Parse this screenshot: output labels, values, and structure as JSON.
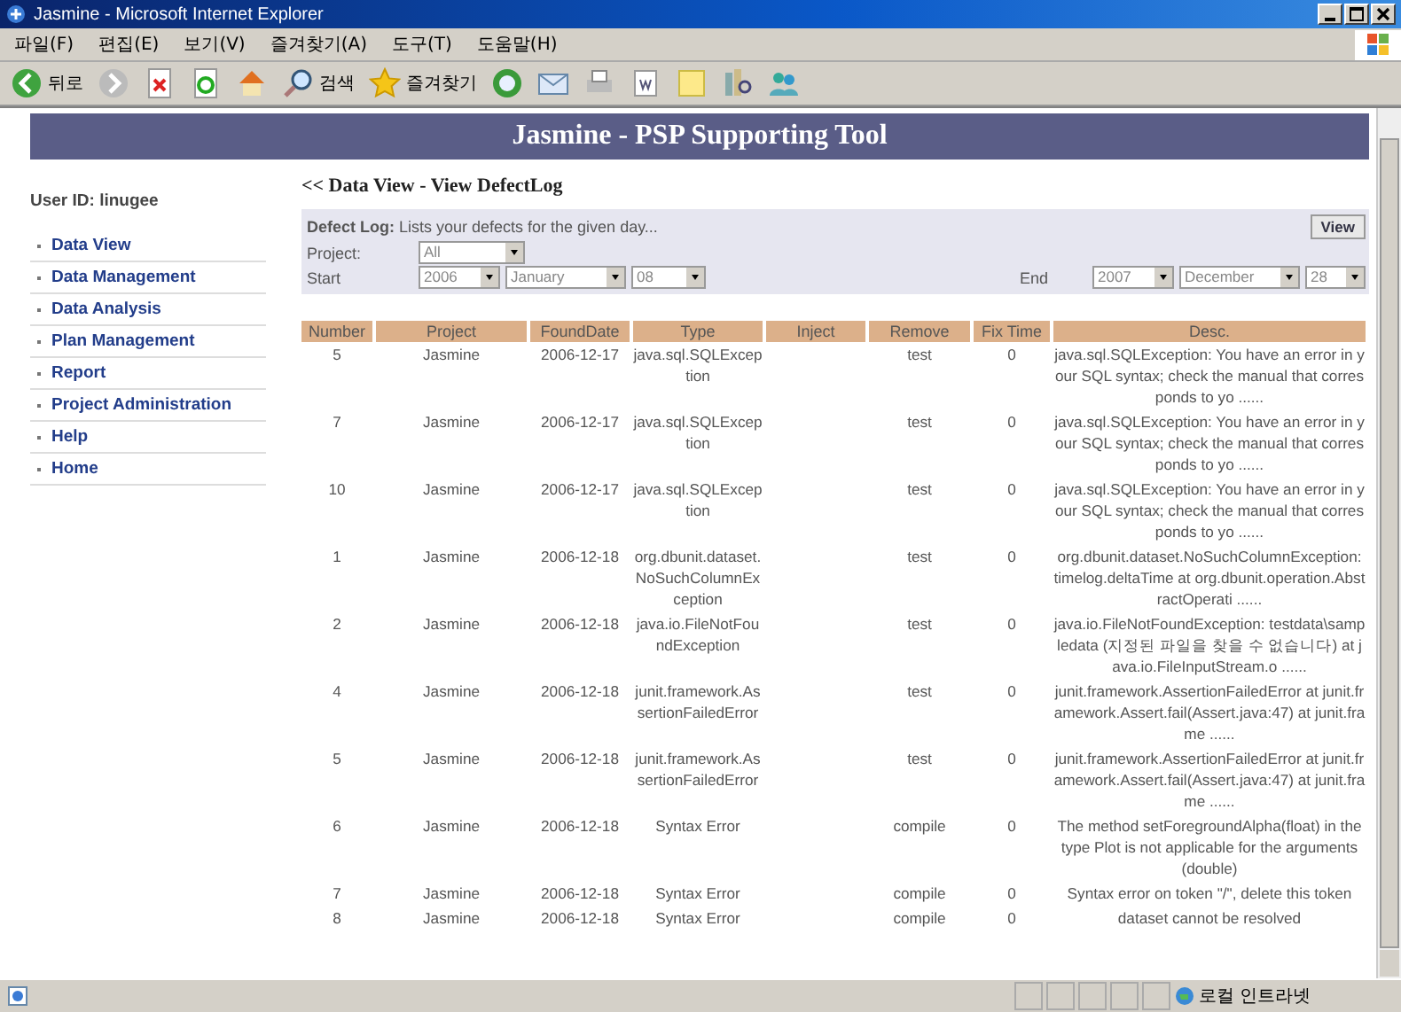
{
  "window": {
    "title": "Jasmine - Microsoft Internet Explorer"
  },
  "menu": [
    "파일(F)",
    "편집(E)",
    "보기(V)",
    "즐겨찾기(A)",
    "도구(T)",
    "도움말(H)"
  ],
  "toolbar": {
    "back": "뒤로",
    "search": "검색",
    "favorites": "즐겨찾기"
  },
  "banner": "Jasmine - PSP Supporting Tool",
  "sidebar": {
    "user": "User ID: linugee",
    "items": [
      "Data View",
      "Data Management",
      "Data Analysis",
      "Plan Management",
      "Report",
      "Project Administration",
      "Help",
      "Home"
    ]
  },
  "breadcrumb": "<< Data View - View DefectLog",
  "filter": {
    "heading": "Defect Log:",
    "description": "Lists your defects for the given day...",
    "button": "View",
    "project_label": "Project:",
    "project": "All",
    "start_label": "Start",
    "start": [
      "2006",
      "January",
      "08"
    ],
    "end_label": "End",
    "end": [
      "2007",
      "December",
      "28"
    ]
  },
  "table": {
    "columns": [
      "Number",
      "Project",
      "FoundDate",
      "Type",
      "Inject",
      "Remove",
      "Fix Time",
      "Desc."
    ],
    "rows": [
      [
        "5",
        "Jasmine",
        "2006-12-17",
        "java.sql.SQLException",
        "",
        "test",
        "0",
        "java.sql.SQLException: You have an error in your SQL syntax; check the manual that corresponds to yo ......"
      ],
      [
        "7",
        "Jasmine",
        "2006-12-17",
        "java.sql.SQLException",
        "",
        "test",
        "0",
        "java.sql.SQLException: You have an error in your SQL syntax; check the manual that corresponds to yo ......"
      ],
      [
        "10",
        "Jasmine",
        "2006-12-17",
        "java.sql.SQLException",
        "",
        "test",
        "0",
        "java.sql.SQLException: You have an error in your SQL syntax; check the manual that corresponds to yo ......"
      ],
      [
        "1",
        "Jasmine",
        "2006-12-18",
        "org.dbunit.dataset.NoSuchColumnException",
        "",
        "test",
        "0",
        "org.dbunit.dataset.NoSuchColumnException: timelog.deltaTime at org.dbunit.operation.AbstractOperati ......"
      ],
      [
        "2",
        "Jasmine",
        "2006-12-18",
        "java.io.FileNotFoundException",
        "",
        "test",
        "0",
        "java.io.FileNotFoundException: testdata\\sampledata (지정된 파일을 찾을 수 없습니다) at java.io.FileInputStream.o ......"
      ],
      [
        "4",
        "Jasmine",
        "2006-12-18",
        "junit.framework.AssertionFailedError",
        "",
        "test",
        "0",
        "junit.framework.AssertionFailedError at junit.framework.Assert.fail(Assert.java:47) at junit.frame ......"
      ],
      [
        "5",
        "Jasmine",
        "2006-12-18",
        "junit.framework.AssertionFailedError",
        "",
        "test",
        "0",
        "junit.framework.AssertionFailedError at junit.framework.Assert.fail(Assert.java:47) at junit.frame ......"
      ],
      [
        "6",
        "Jasmine",
        "2006-12-18",
        "Syntax Error",
        "",
        "compile",
        "0",
        "The method setForegroundAlpha(float) in the type Plot is not applicable for the arguments (double)"
      ],
      [
        "7",
        "Jasmine",
        "2006-12-18",
        "Syntax Error",
        "",
        "compile",
        "0",
        "Syntax error on token \"/\", delete this token"
      ],
      [
        "8",
        "Jasmine",
        "2006-12-18",
        "Syntax Error",
        "",
        "compile",
        "0",
        "dataset cannot be resolved"
      ]
    ]
  },
  "status_bar": {
    "zone": "로컬 인트라넷"
  }
}
